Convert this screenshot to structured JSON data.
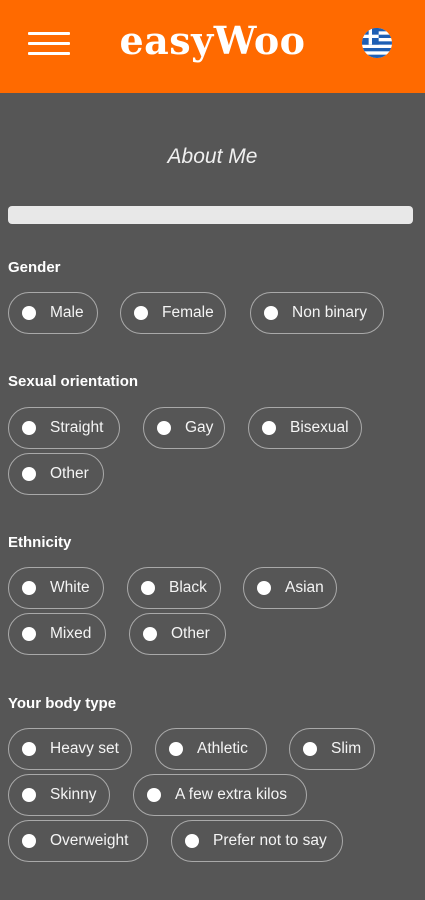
{
  "header": {
    "logo": "easyWoo",
    "menu_icon": "hamburger-menu-icon",
    "language_icon": "greek-flag-icon"
  },
  "colors": {
    "accent": "#ff6a00",
    "background": "#565656",
    "pill_border": "#a9a9a9"
  },
  "page": {
    "title": "About Me",
    "progress": 0
  },
  "sections": {
    "gender": {
      "label": "Gender",
      "options": [
        "Male",
        "Female",
        "Non binary"
      ]
    },
    "orientation": {
      "label": "Sexual orientation",
      "options": [
        "Straight",
        "Gay",
        "Bisexual",
        "Other"
      ]
    },
    "ethnicity": {
      "label": "Ethnicity",
      "options": [
        "White",
        "Black",
        "Asian",
        "Mixed",
        "Other"
      ]
    },
    "body": {
      "label": "Your body type",
      "options": [
        "Heavy set",
        "Athletic",
        "Slim",
        "Skinny",
        "A few extra kilos",
        "Overweight",
        "Prefer not to say"
      ]
    }
  }
}
